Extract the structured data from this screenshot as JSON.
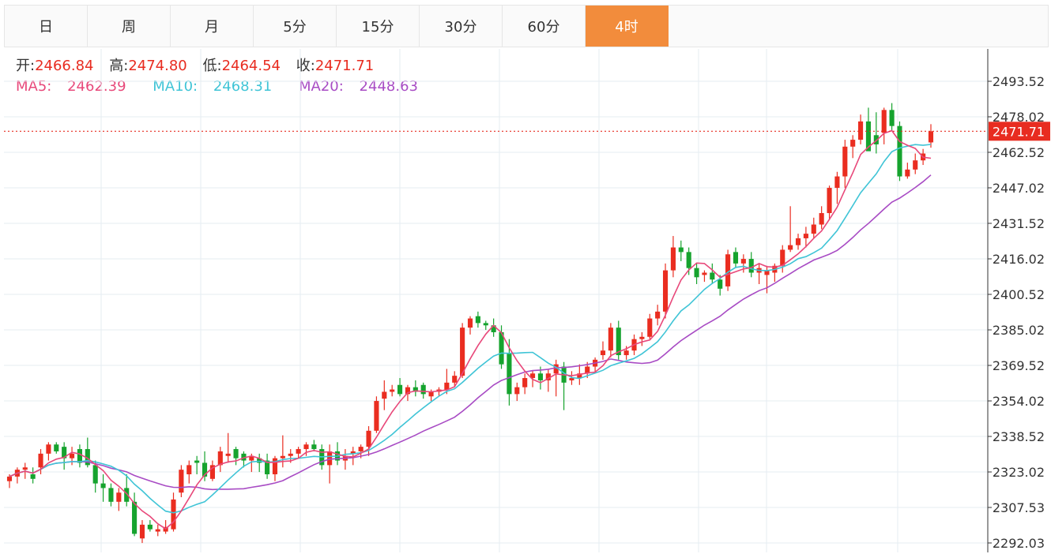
{
  "tabs": [
    {
      "label": "日",
      "active": false
    },
    {
      "label": "周",
      "active": false
    },
    {
      "label": "月",
      "active": false
    },
    {
      "label": "5分",
      "active": false
    },
    {
      "label": "15分",
      "active": false
    },
    {
      "label": "30分",
      "active": false
    },
    {
      "label": "60分",
      "active": false
    },
    {
      "label": "4时",
      "active": true
    }
  ],
  "ohlc": {
    "open_label": "开:",
    "open": "2466.84",
    "high_label": "高:",
    "high": "2474.80",
    "low_label": "低:",
    "low": "2464.54",
    "close_label": "收:",
    "close": "2471.71"
  },
  "ma_info": {
    "ma5_label": "MA5:",
    "ma5": "2462.39",
    "ma10_label": "MA10:",
    "ma10": "2468.31",
    "ma20_label": "MA20:",
    "ma20": "2448.63"
  },
  "colors": {
    "up": "#ea2d20",
    "down": "#16a32e",
    "ma5": "#e8487a",
    "ma10": "#3fc4d6",
    "ma20": "#a84bc4",
    "accent": "#f28c3c",
    "grid": "#e6ecf2",
    "last_price_tag": "#e82c20"
  },
  "chart_data": {
    "type": "candlestick",
    "y_ticks": [
      "2493.52",
      "2478.02",
      "2462.52",
      "2447.02",
      "2431.52",
      "2416.02",
      "2400.52",
      "2385.02",
      "2369.52",
      "2354.02",
      "2338.52",
      "2323.02",
      "2307.53",
      "2292.03"
    ],
    "ylim": [
      2292.03,
      2493.52
    ],
    "last_price": "2471.71",
    "grid": true,
    "candles": [
      [
        2319,
        2322,
        2316,
        2321
      ],
      [
        2321,
        2325,
        2318,
        2324
      ],
      [
        2324,
        2327,
        2320,
        2325
      ],
      [
        2322,
        2325,
        2318,
        2320
      ],
      [
        2325,
        2333,
        2322,
        2331
      ],
      [
        2331,
        2336,
        2328,
        2335
      ],
      [
        2335,
        2336,
        2331,
        2332
      ],
      [
        2334,
        2336,
        2324,
        2329
      ],
      [
        2329,
        2334,
        2326,
        2331
      ],
      [
        2333,
        2335,
        2325,
        2327
      ],
      [
        2333,
        2338,
        2325,
        2326
      ],
      [
        2326,
        2328,
        2314,
        2318
      ],
      [
        2318,
        2322,
        2310,
        2316
      ],
      [
        2316,
        2318,
        2308,
        2310
      ],
      [
        2310,
        2316,
        2306,
        2314
      ],
      [
        2316,
        2322,
        2308,
        2310
      ],
      [
        2310,
        2314,
        2295,
        2296
      ],
      [
        2294,
        2302,
        2292,
        2300
      ],
      [
        2300,
        2302,
        2297,
        2298
      ],
      [
        2297,
        2300,
        2295,
        2298
      ],
      [
        2297,
        2302,
        2296,
        2299
      ],
      [
        2298,
        2314,
        2297,
        2311
      ],
      [
        2314,
        2326,
        2312,
        2324
      ],
      [
        2322,
        2328,
        2318,
        2326
      ],
      [
        2328,
        2330,
        2322,
        2327
      ],
      [
        2327,
        2332,
        2319,
        2321
      ],
      [
        2320,
        2328,
        2319,
        2326
      ],
      [
        2326,
        2334,
        2323,
        2332
      ],
      [
        2330,
        2340,
        2327,
        2331
      ],
      [
        2333,
        2334,
        2326,
        2329
      ],
      [
        2331,
        2332,
        2325,
        2328
      ],
      [
        2328,
        2331,
        2323,
        2330
      ],
      [
        2329,
        2331,
        2323,
        2327
      ],
      [
        2328,
        2331,
        2320,
        2322
      ],
      [
        2322,
        2330,
        2319,
        2329
      ],
      [
        2329,
        2339,
        2325,
        2330
      ],
      [
        2330,
        2333,
        2327,
        2331
      ],
      [
        2331,
        2334,
        2329,
        2333
      ],
      [
        2333,
        2336,
        2330,
        2335
      ],
      [
        2335,
        2337,
        2332,
        2333
      ],
      [
        2333,
        2335,
        2324,
        2326
      ],
      [
        2326,
        2335,
        2318,
        2332
      ],
      [
        2332,
        2336,
        2326,
        2328
      ],
      [
        2328,
        2333,
        2324,
        2330
      ],
      [
        2331,
        2334,
        2326,
        2332
      ],
      [
        2332,
        2335,
        2329,
        2334
      ],
      [
        2334,
        2343,
        2330,
        2341
      ],
      [
        2341,
        2356,
        2340,
        2354
      ],
      [
        2355,
        2363,
        2350,
        2358
      ],
      [
        2358,
        2361,
        2356,
        2359
      ],
      [
        2361,
        2364,
        2356,
        2357
      ],
      [
        2357,
        2361,
        2354,
        2360
      ],
      [
        2360,
        2363,
        2356,
        2358
      ],
      [
        2361,
        2362,
        2355,
        2357
      ],
      [
        2356,
        2359,
        2354,
        2358
      ],
      [
        2358,
        2360,
        2356,
        2359
      ],
      [
        2359,
        2368,
        2357,
        2362
      ],
      [
        2362,
        2367,
        2360,
        2365
      ],
      [
        2365,
        2388,
        2364,
        2386
      ],
      [
        2386,
        2391,
        2383,
        2390
      ],
      [
        2391,
        2393,
        2386,
        2388
      ],
      [
        2388,
        2389,
        2385,
        2387
      ],
      [
        2387,
        2390,
        2382,
        2384
      ],
      [
        2384,
        2387,
        2368,
        2370
      ],
      [
        2375,
        2381,
        2352,
        2357
      ],
      [
        2357,
        2362,
        2354,
        2360
      ],
      [
        2360,
        2366,
        2357,
        2364
      ],
      [
        2364,
        2367,
        2360,
        2366
      ],
      [
        2366,
        2369,
        2359,
        2363
      ],
      [
        2363,
        2368,
        2358,
        2366
      ],
      [
        2366,
        2372,
        2356,
        2370
      ],
      [
        2369,
        2371,
        2350,
        2362
      ],
      [
        2363,
        2367,
        2361,
        2364
      ],
      [
        2364,
        2370,
        2361,
        2366
      ],
      [
        2366,
        2371,
        2364,
        2369
      ],
      [
        2369,
        2373,
        2366,
        2372
      ],
      [
        2374,
        2380,
        2372,
        2376
      ],
      [
        2376,
        2388,
        2373,
        2386
      ],
      [
        2386,
        2389,
        2372,
        2374
      ],
      [
        2374,
        2378,
        2372,
        2376
      ],
      [
        2376,
        2383,
        2374,
        2381
      ],
      [
        2381,
        2384,
        2378,
        2382
      ],
      [
        2382,
        2392,
        2381,
        2390
      ],
      [
        2390,
        2396,
        2387,
        2393
      ],
      [
        2393,
        2414,
        2390,
        2411
      ],
      [
        2411,
        2426,
        2408,
        2421
      ],
      [
        2421,
        2424,
        2415,
        2419
      ],
      [
        2419,
        2421,
        2409,
        2412
      ],
      [
        2412,
        2414,
        2405,
        2408
      ],
      [
        2409,
        2411,
        2406,
        2410
      ],
      [
        2410,
        2414,
        2405,
        2407
      ],
      [
        2407,
        2409,
        2400,
        2403
      ],
      [
        2404,
        2420,
        2402,
        2418
      ],
      [
        2419,
        2421,
        2412,
        2414
      ],
      [
        2414,
        2418,
        2410,
        2416
      ],
      [
        2416,
        2419,
        2408,
        2410
      ],
      [
        2410,
        2414,
        2405,
        2412
      ],
      [
        2409,
        2413,
        2401,
        2411
      ],
      [
        2410,
        2414,
        2406,
        2413
      ],
      [
        2413,
        2422,
        2410,
        2420
      ],
      [
        2420,
        2439,
        2419,
        2422
      ],
      [
        2422,
        2427,
        2420,
        2425
      ],
      [
        2425,
        2430,
        2421,
        2427
      ],
      [
        2427,
        2434,
        2425,
        2431
      ],
      [
        2431,
        2439,
        2429,
        2436
      ],
      [
        2436,
        2448,
        2433,
        2447
      ],
      [
        2447,
        2454,
        2440,
        2452
      ],
      [
        2452,
        2468,
        2447,
        2465
      ],
      [
        2465,
        2470,
        2460,
        2468
      ],
      [
        2468,
        2479,
        2466,
        2476
      ],
      [
        2476,
        2482,
        2468,
        2463
      ],
      [
        2470,
        2480,
        2462,
        2466
      ],
      [
        2471,
        2482,
        2466,
        2481
      ],
      [
        2481,
        2484,
        2472,
        2474
      ],
      [
        2474,
        2476,
        2450,
        2452
      ],
      [
        2452,
        2458,
        2451,
        2455
      ],
      [
        2455,
        2462,
        2453,
        2459
      ],
      [
        2459,
        2464,
        2457,
        2462
      ],
      [
        2466.84,
        2474.8,
        2464.54,
        2471.71
      ]
    ]
  }
}
